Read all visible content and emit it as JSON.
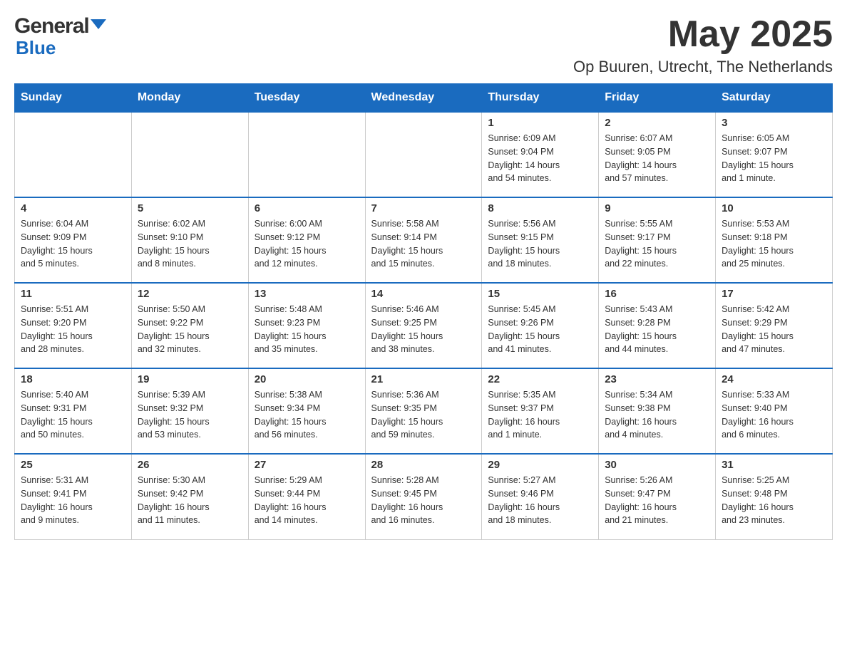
{
  "header": {
    "logo_general": "General",
    "logo_blue": "Blue",
    "month_year": "May 2025",
    "location": "Op Buuren, Utrecht, The Netherlands"
  },
  "days_of_week": [
    "Sunday",
    "Monday",
    "Tuesday",
    "Wednesday",
    "Thursday",
    "Friday",
    "Saturday"
  ],
  "weeks": [
    [
      {
        "day": "",
        "info": ""
      },
      {
        "day": "",
        "info": ""
      },
      {
        "day": "",
        "info": ""
      },
      {
        "day": "",
        "info": ""
      },
      {
        "day": "1",
        "info": "Sunrise: 6:09 AM\nSunset: 9:04 PM\nDaylight: 14 hours\nand 54 minutes."
      },
      {
        "day": "2",
        "info": "Sunrise: 6:07 AM\nSunset: 9:05 PM\nDaylight: 14 hours\nand 57 minutes."
      },
      {
        "day": "3",
        "info": "Sunrise: 6:05 AM\nSunset: 9:07 PM\nDaylight: 15 hours\nand 1 minute."
      }
    ],
    [
      {
        "day": "4",
        "info": "Sunrise: 6:04 AM\nSunset: 9:09 PM\nDaylight: 15 hours\nand 5 minutes."
      },
      {
        "day": "5",
        "info": "Sunrise: 6:02 AM\nSunset: 9:10 PM\nDaylight: 15 hours\nand 8 minutes."
      },
      {
        "day": "6",
        "info": "Sunrise: 6:00 AM\nSunset: 9:12 PM\nDaylight: 15 hours\nand 12 minutes."
      },
      {
        "day": "7",
        "info": "Sunrise: 5:58 AM\nSunset: 9:14 PM\nDaylight: 15 hours\nand 15 minutes."
      },
      {
        "day": "8",
        "info": "Sunrise: 5:56 AM\nSunset: 9:15 PM\nDaylight: 15 hours\nand 18 minutes."
      },
      {
        "day": "9",
        "info": "Sunrise: 5:55 AM\nSunset: 9:17 PM\nDaylight: 15 hours\nand 22 minutes."
      },
      {
        "day": "10",
        "info": "Sunrise: 5:53 AM\nSunset: 9:18 PM\nDaylight: 15 hours\nand 25 minutes."
      }
    ],
    [
      {
        "day": "11",
        "info": "Sunrise: 5:51 AM\nSunset: 9:20 PM\nDaylight: 15 hours\nand 28 minutes."
      },
      {
        "day": "12",
        "info": "Sunrise: 5:50 AM\nSunset: 9:22 PM\nDaylight: 15 hours\nand 32 minutes."
      },
      {
        "day": "13",
        "info": "Sunrise: 5:48 AM\nSunset: 9:23 PM\nDaylight: 15 hours\nand 35 minutes."
      },
      {
        "day": "14",
        "info": "Sunrise: 5:46 AM\nSunset: 9:25 PM\nDaylight: 15 hours\nand 38 minutes."
      },
      {
        "day": "15",
        "info": "Sunrise: 5:45 AM\nSunset: 9:26 PM\nDaylight: 15 hours\nand 41 minutes."
      },
      {
        "day": "16",
        "info": "Sunrise: 5:43 AM\nSunset: 9:28 PM\nDaylight: 15 hours\nand 44 minutes."
      },
      {
        "day": "17",
        "info": "Sunrise: 5:42 AM\nSunset: 9:29 PM\nDaylight: 15 hours\nand 47 minutes."
      }
    ],
    [
      {
        "day": "18",
        "info": "Sunrise: 5:40 AM\nSunset: 9:31 PM\nDaylight: 15 hours\nand 50 minutes."
      },
      {
        "day": "19",
        "info": "Sunrise: 5:39 AM\nSunset: 9:32 PM\nDaylight: 15 hours\nand 53 minutes."
      },
      {
        "day": "20",
        "info": "Sunrise: 5:38 AM\nSunset: 9:34 PM\nDaylight: 15 hours\nand 56 minutes."
      },
      {
        "day": "21",
        "info": "Sunrise: 5:36 AM\nSunset: 9:35 PM\nDaylight: 15 hours\nand 59 minutes."
      },
      {
        "day": "22",
        "info": "Sunrise: 5:35 AM\nSunset: 9:37 PM\nDaylight: 16 hours\nand 1 minute."
      },
      {
        "day": "23",
        "info": "Sunrise: 5:34 AM\nSunset: 9:38 PM\nDaylight: 16 hours\nand 4 minutes."
      },
      {
        "day": "24",
        "info": "Sunrise: 5:33 AM\nSunset: 9:40 PM\nDaylight: 16 hours\nand 6 minutes."
      }
    ],
    [
      {
        "day": "25",
        "info": "Sunrise: 5:31 AM\nSunset: 9:41 PM\nDaylight: 16 hours\nand 9 minutes."
      },
      {
        "day": "26",
        "info": "Sunrise: 5:30 AM\nSunset: 9:42 PM\nDaylight: 16 hours\nand 11 minutes."
      },
      {
        "day": "27",
        "info": "Sunrise: 5:29 AM\nSunset: 9:44 PM\nDaylight: 16 hours\nand 14 minutes."
      },
      {
        "day": "28",
        "info": "Sunrise: 5:28 AM\nSunset: 9:45 PM\nDaylight: 16 hours\nand 16 minutes."
      },
      {
        "day": "29",
        "info": "Sunrise: 5:27 AM\nSunset: 9:46 PM\nDaylight: 16 hours\nand 18 minutes."
      },
      {
        "day": "30",
        "info": "Sunrise: 5:26 AM\nSunset: 9:47 PM\nDaylight: 16 hours\nand 21 minutes."
      },
      {
        "day": "31",
        "info": "Sunrise: 5:25 AM\nSunset: 9:48 PM\nDaylight: 16 hours\nand 23 minutes."
      }
    ]
  ],
  "colors": {
    "header_bg": "#1a6bbf",
    "header_text": "#ffffff",
    "border": "#1a6bbf",
    "text": "#333333",
    "blue": "#1a6bbf"
  }
}
